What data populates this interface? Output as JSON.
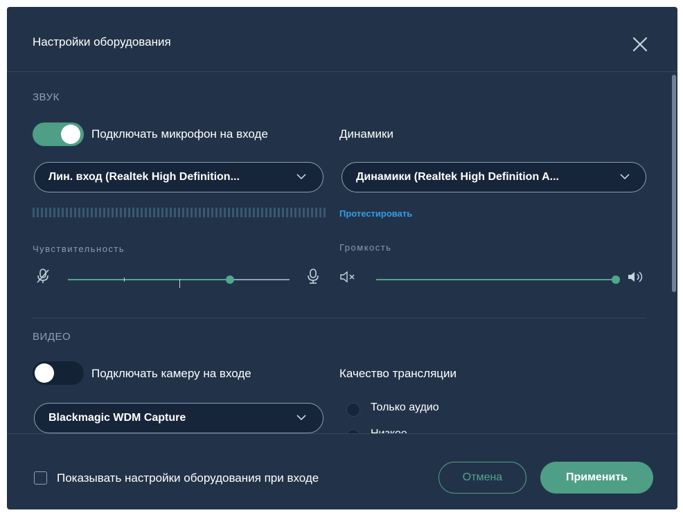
{
  "dialog": {
    "title": "Настройки оборудования"
  },
  "sound": {
    "section_label": "ЗВУК",
    "mic_toggle_label": "Подключать микрофон на входе",
    "mic_toggle_on": true,
    "mic_device": "Лин. вход (Realtek High Definition...",
    "speakers_label": "Динамики",
    "speaker_device": "Динамики (Realtek High Definition A...",
    "test_link": "Протестировать",
    "sensitivity_label": "Чувствительность",
    "sensitivity_level": 0.73,
    "volume_label": "Громкость",
    "volume_level": 1.0
  },
  "video": {
    "section_label": "ВИДЕО",
    "camera_toggle_label": "Подключать камеру на входе",
    "camera_toggle_on": false,
    "camera_device": "Blackmagic WDM Capture",
    "quality_label": "Качество трансляции",
    "quality_options": [
      "Только аудио",
      "Низкое"
    ]
  },
  "footer": {
    "show_on_join_label": "Показывать настройки оборудования при входе",
    "show_on_join_checked": false,
    "cancel_label": "Отмена",
    "apply_label": "Применить"
  },
  "colors": {
    "dialog_bg": "#223349",
    "accent": "#4f9e86",
    "link": "#2f9ee8",
    "muted_text": "#8a9cb0"
  },
  "icons": {
    "close": "close-icon",
    "mic_muted": "mic-muted-icon",
    "mic": "mic-icon",
    "speaker_muted": "speaker-muted-icon",
    "speaker": "speaker-icon",
    "chevron": "chevron-down-icon"
  }
}
